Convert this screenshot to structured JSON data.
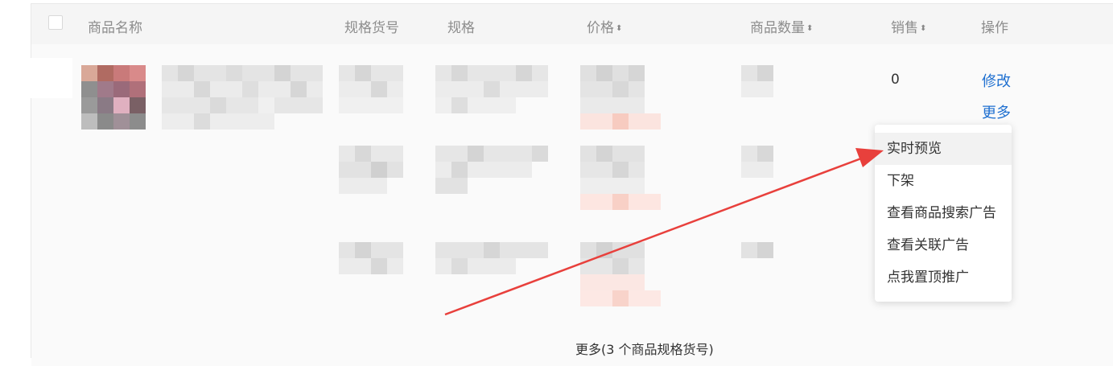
{
  "table": {
    "headers": {
      "name": "商品名称",
      "spec_code": "规格货号",
      "spec": "规格",
      "price": "价格",
      "quantity": "商品数量",
      "sales": "销售",
      "action": "操作"
    },
    "sort_icon": "sort-icon"
  },
  "row": {
    "sales_value": "0",
    "edit_link": "修改",
    "more_link": "更多"
  },
  "dropdown": {
    "items": [
      "实时预览",
      "下架",
      "查看商品搜索广告",
      "查看关联广告",
      "点我置顶推广"
    ],
    "highlighted_index": 0
  },
  "footer": {
    "more_specs": "更多(3 个商品规格货号)"
  },
  "colors": {
    "link": "#1e6fd0",
    "arrow": "#e8403c",
    "header_bg": "#f5f5f5"
  }
}
